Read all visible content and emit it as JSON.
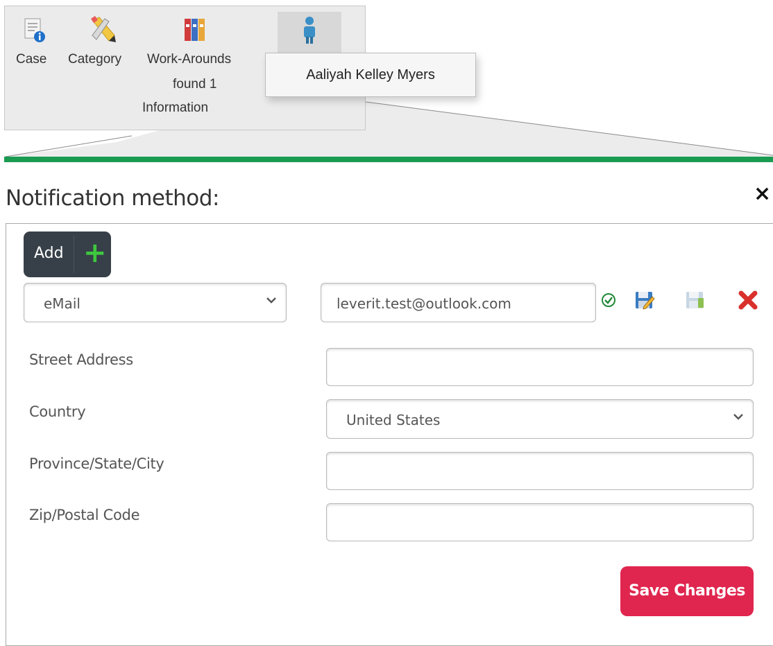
{
  "toolbar": {
    "items": [
      {
        "label": "Case",
        "icon": "case-info-icon"
      },
      {
        "label": "Category",
        "icon": "pencil-ruler-icon"
      },
      {
        "label": "Work-Arounds",
        "sublabel1": "found 1",
        "sublabel2": "Information",
        "icon": "binders-icon"
      },
      {
        "label": "",
        "icon": "person-icon"
      }
    ],
    "popup_name": "Aaliyah Kelley Myers",
    "accent_color": "#1a9b51"
  },
  "dialog": {
    "title": "Notification method:",
    "close_glyph": "×",
    "add_label": "Add",
    "method": {
      "selected": "eMail",
      "value": "leverit.test@outlook.com"
    },
    "fields": [
      {
        "label": "Street Address",
        "value": ""
      },
      {
        "label": "Country",
        "value": "United States"
      },
      {
        "label": "Province/State/City",
        "value": ""
      },
      {
        "label": "Zip/Postal Code",
        "value": ""
      }
    ],
    "save_label": "Save Changes",
    "save_color": "#e0264f"
  }
}
